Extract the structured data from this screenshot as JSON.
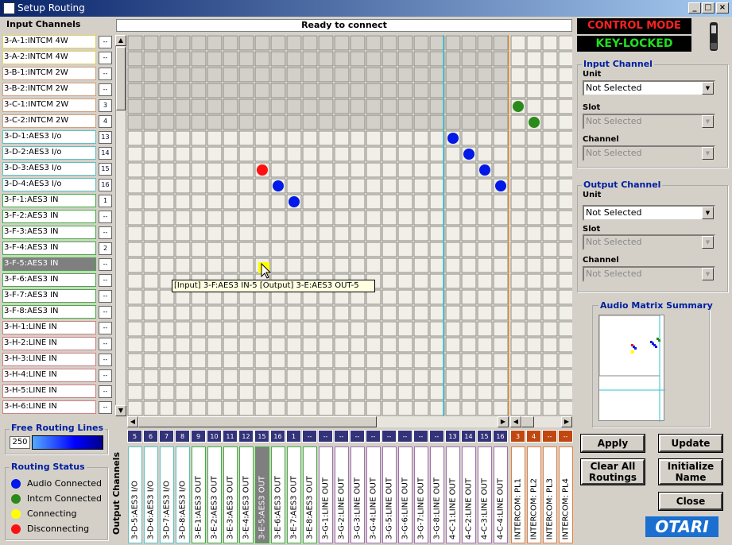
{
  "window": {
    "title": "Setup Routing",
    "min": "_",
    "max": "□",
    "close": "×"
  },
  "status": "Ready to connect",
  "input_label": "Input Channels",
  "output_label": "Output Channels",
  "control_mode": "CONTROL MODE",
  "key_locked": "KEY-LOCKED",
  "inputs": [
    {
      "label": "3-A-1:INTCM 4W",
      "num": "--",
      "color": "#e0d060"
    },
    {
      "label": "3-A-2:INTCM 4W",
      "num": "--",
      "color": "#e0d060"
    },
    {
      "label": "3-B-1:INTCM 2W",
      "num": "--",
      "color": "#d0a080"
    },
    {
      "label": "3-B-2:INTCM 2W",
      "num": "--",
      "color": "#d0a080"
    },
    {
      "label": "3-C-1:INTCM 2W",
      "num": "3",
      "color": "#d0a080"
    },
    {
      "label": "3-C-2:INTCM 2W",
      "num": "4",
      "color": "#d0a080"
    },
    {
      "label": "3-D-1:AES3 I/o",
      "num": "13",
      "color": "#60c0c0"
    },
    {
      "label": "3-D-2:AES3 I/o",
      "num": "14",
      "color": "#60c0c0"
    },
    {
      "label": "3-D-3:AES3 I/o",
      "num": "15",
      "color": "#60c0c0"
    },
    {
      "label": "3-D-4:AES3 I/o",
      "num": "16",
      "color": "#60c0c0"
    },
    {
      "label": "3-F-1:AES3 IN",
      "num": "1",
      "color": "#40b040"
    },
    {
      "label": "3-F-2:AES3 IN",
      "num": "--",
      "color": "#40b040"
    },
    {
      "label": "3-F-3:AES3 IN",
      "num": "--",
      "color": "#40b040"
    },
    {
      "label": "3-F-4:AES3 IN",
      "num": "2",
      "color": "#40b040"
    },
    {
      "label": "3-F-5:AES3 IN",
      "num": "--",
      "color": "#40b040",
      "selected": true
    },
    {
      "label": "3-F-6:AES3 IN",
      "num": "--",
      "color": "#40b040"
    },
    {
      "label": "3-F-7:AES3 IN",
      "num": "--",
      "color": "#40b040"
    },
    {
      "label": "3-F-8:AES3 IN",
      "num": "--",
      "color": "#40b040"
    },
    {
      "label": "3-H-1:LINE IN",
      "num": "--",
      "color": "#d08080"
    },
    {
      "label": "3-H-2:LINE IN",
      "num": "--",
      "color": "#d08080"
    },
    {
      "label": "3-H-3:LINE IN",
      "num": "--",
      "color": "#d08080"
    },
    {
      "label": "3-H-4:LINE IN",
      "num": "--",
      "color": "#d08080"
    },
    {
      "label": "3-H-5:LINE IN",
      "num": "--",
      "color": "#d08080"
    },
    {
      "label": "3-H-6:LINE IN",
      "num": "--",
      "color": "#d08080"
    }
  ],
  "outputs": [
    {
      "label": "3-D-5:AES3 I/O",
      "num": "5",
      "color": "#60c0c0"
    },
    {
      "label": "3-D-6:AES3 I/O",
      "num": "6",
      "color": "#60c0c0"
    },
    {
      "label": "3-D-7:AES3 I/O",
      "num": "7",
      "color": "#60c0c0"
    },
    {
      "label": "3-D-8:AES3 I/O",
      "num": "8",
      "color": "#60c0c0"
    },
    {
      "label": "3-E-1:AES3 OUT",
      "num": "9",
      "color": "#40b040"
    },
    {
      "label": "3-E-2:AES3 OUT",
      "num": "10",
      "color": "#40b040"
    },
    {
      "label": "3-E-3:AES3 OUT",
      "num": "11",
      "color": "#40b040"
    },
    {
      "label": "3-E-4:AES3 OUT",
      "num": "12",
      "color": "#40b040"
    },
    {
      "label": "3-E-5:AES3 OUT",
      "num": "15",
      "color": "#40b040",
      "selected": true
    },
    {
      "label": "3-E-6:AES3 OUT",
      "num": "16",
      "color": "#40b040"
    },
    {
      "label": "3-E-7:AES3 OUT",
      "num": "1",
      "color": "#40b040"
    },
    {
      "label": "3-E-8:AES3 OUT",
      "num": "--",
      "color": "#40b040"
    },
    {
      "label": "3-G-1:LINE OUT",
      "num": "--",
      "color": "#a070b0"
    },
    {
      "label": "3-G-2:LINE OUT",
      "num": "--",
      "color": "#a070b0"
    },
    {
      "label": "3-G-3:LINE OUT",
      "num": "--",
      "color": "#a070b0"
    },
    {
      "label": "3-G-4:LINE OUT",
      "num": "--",
      "color": "#a070b0"
    },
    {
      "label": "3-G-5:LINE OUT",
      "num": "--",
      "color": "#a070b0"
    },
    {
      "label": "3-G-6:LINE OUT",
      "num": "--",
      "color": "#a070b0"
    },
    {
      "label": "3-G-7:LINE OUT",
      "num": "--",
      "color": "#a070b0"
    },
    {
      "label": "3-G-8:LINE OUT",
      "num": "--",
      "color": "#a070b0"
    },
    {
      "label": "4-C-1:LINE OUT",
      "num": "13",
      "color": "#a070b0"
    },
    {
      "label": "4-C-2:LINE OUT",
      "num": "14",
      "color": "#a070b0"
    },
    {
      "label": "4-C-3:LINE OUT",
      "num": "15",
      "color": "#a070b0"
    },
    {
      "label": "4-C-4:LINE OUT",
      "num": "16",
      "color": "#a070b0"
    },
    {
      "label": "INTERCOM: PL1",
      "num": "3",
      "color": "#e08040",
      "orange": true
    },
    {
      "label": "INTERCOM: PL2",
      "num": "4",
      "color": "#e08040",
      "orange": true
    },
    {
      "label": "INTERCOM: PL3",
      "num": "--",
      "color": "#e08040",
      "orange": true
    },
    {
      "label": "INTERCOM: PL4",
      "num": "--",
      "color": "#e08040",
      "orange": true
    }
  ],
  "routes": [
    {
      "row": 8,
      "col": 8,
      "state": "disconnecting"
    },
    {
      "row": 9,
      "col": 9,
      "state": "audio"
    },
    {
      "row": 10,
      "col": 10,
      "state": "audio"
    },
    {
      "row": 6,
      "col": 20,
      "state": "audio"
    },
    {
      "row": 7,
      "col": 21,
      "state": "audio"
    },
    {
      "row": 8,
      "col": 22,
      "state": "audio"
    },
    {
      "row": 9,
      "col": 23,
      "state": "audio"
    },
    {
      "row": 4,
      "col": 24,
      "state": "intcm"
    },
    {
      "row": 5,
      "col": 25,
      "state": "intcm"
    }
  ],
  "state_colors": {
    "audio": "#0018e8",
    "intcm": "#2a8a1a",
    "connecting": "#ffff00",
    "disconnecting": "#ff1010"
  },
  "tooltip": "[Input] 3-F:AES3 IN-5   [Output] 3-E:AES3 OUT-5",
  "input_channel": {
    "title": "Input Channel",
    "unit_label": "Unit",
    "unit": "Not Selected",
    "slot_label": "Slot",
    "slot": "Not Selected",
    "channel_label": "Channel",
    "channel": "Not Selected"
  },
  "output_channel": {
    "title": "Output Channel",
    "unit_label": "Unit",
    "unit": "Not Selected",
    "slot_label": "Slot",
    "slot": "Not Selected",
    "channel_label": "Channel",
    "channel": "Not Selected"
  },
  "summary_title": "Audio Matrix Summary",
  "buttons": {
    "apply": "Apply",
    "update": "Update",
    "clear": "Clear All Routings",
    "init": "Initialize Name",
    "close": "Close"
  },
  "free_routing": {
    "title": "Free Routing Lines",
    "value": "250"
  },
  "routing_status": {
    "title": "Routing Status",
    "audio": "Audio Connected",
    "intcm": "Intcm Connected",
    "connecting": "Connecting",
    "disconnecting": "Disconnecting"
  },
  "logo": "OTARI"
}
